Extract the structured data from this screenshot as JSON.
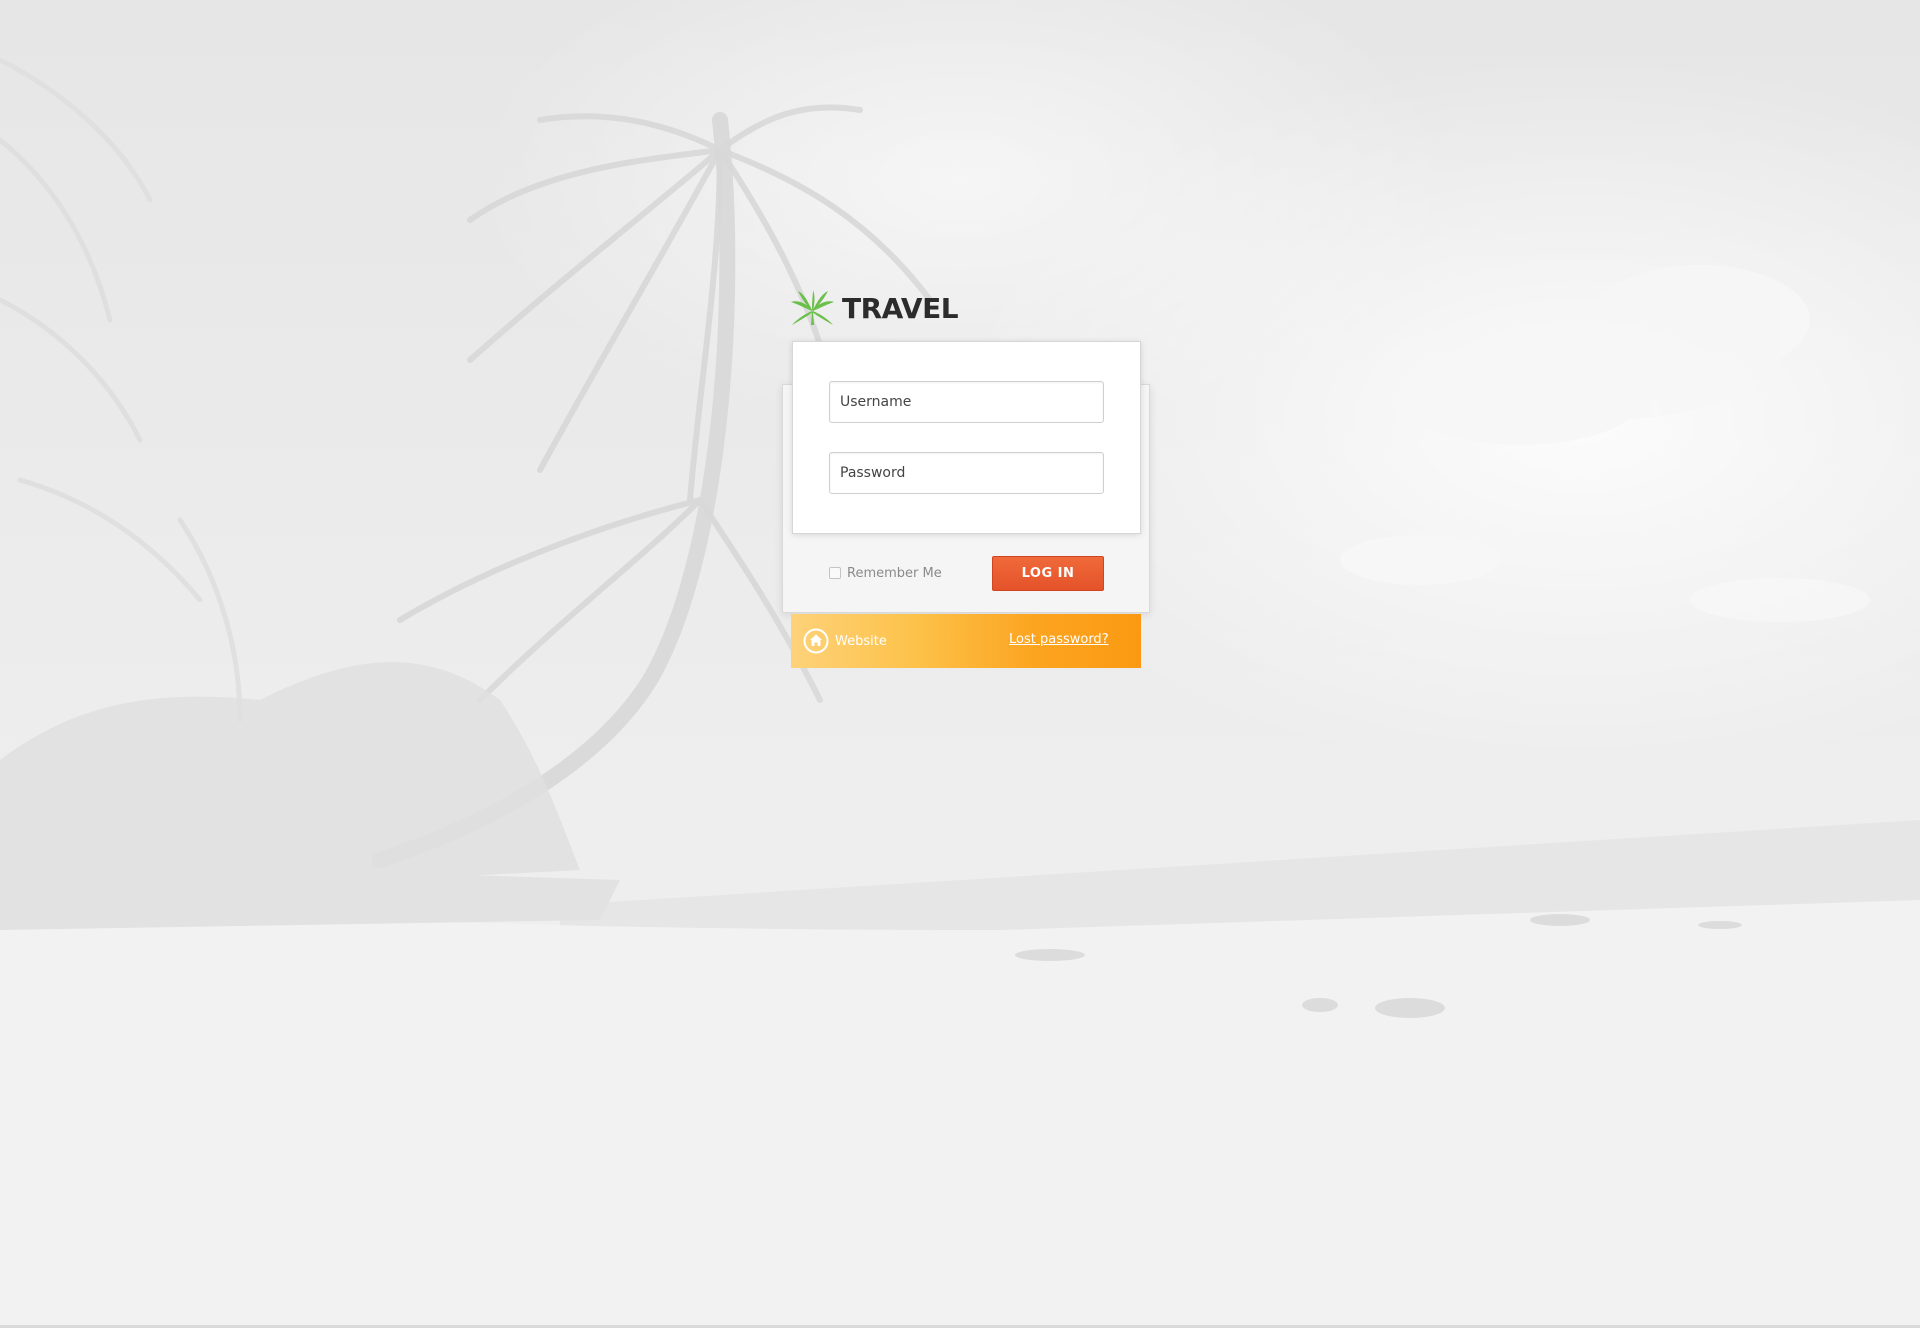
{
  "brand": {
    "logo_icon": "palm-leaf-icon",
    "name": "TRAVEL",
    "accent_color": "#6cbf4b"
  },
  "login_form": {
    "username_placeholder": "Username",
    "password_placeholder": "Password",
    "remember_label": "Remember Me",
    "remember_checked": false,
    "submit_label": "LOG IN",
    "submit_color": "#e85c30"
  },
  "footer": {
    "website_icon": "home-icon",
    "website_label": "Website",
    "lost_password_label": "Lost password?",
    "bar_color": "#fca420"
  }
}
